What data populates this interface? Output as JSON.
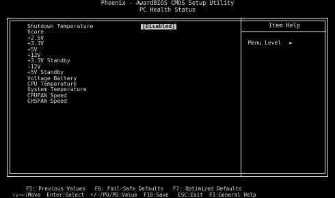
{
  "header": {
    "line1": "Phoenix - AwardBIOS CMOS Setup Utility",
    "line2": "PC Health Status"
  },
  "items": [
    {
      "label": "Shutdown Temperature",
      "value": "[Disabled]"
    },
    {
      "label": "Vcore"
    },
    {
      "label": "+2.5V"
    },
    {
      "label": "+3.3V"
    },
    {
      "label": "+5V"
    },
    {
      "label": "+12V"
    },
    {
      "label": "+3.3V Standby"
    },
    {
      "label": "-12V"
    },
    {
      "label": "+5V Standby"
    },
    {
      "label": "Voltage Battery"
    },
    {
      "label": "CPU Temperature"
    },
    {
      "label": "System Temperature"
    },
    {
      "label": "CPUFAN Speed"
    },
    {
      "label": "CHSFAN Speed"
    }
  ],
  "help": {
    "title": "Item Help",
    "menu_level": "Menu Level",
    "arrow": "►"
  },
  "footer": {
    "line1": "↑↓→←:Move  Enter:Select  +/-/PU/PD:Value  F10:Save   ESC:Exit  F1:General Help",
    "line2": "F5: Previous Values   F6: Fail-Safe Defaults   F7: Optimized Defaults"
  }
}
